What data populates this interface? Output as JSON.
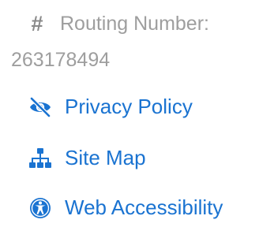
{
  "routing": {
    "icon": "hash-icon",
    "label": "Routing Number:",
    "number": "263178494"
  },
  "links": {
    "privacy": {
      "label": "Privacy Policy",
      "icon": "eye-slash-icon"
    },
    "sitemap": {
      "label": "Site Map",
      "icon": "sitemap-icon"
    },
    "accessibility": {
      "label": "Web Accessibility",
      "icon": "universal-access-icon"
    }
  },
  "colors": {
    "link": "#1a73d1",
    "muted_text": "#9e9e9e",
    "hash_icon": "#8a8a8a"
  }
}
